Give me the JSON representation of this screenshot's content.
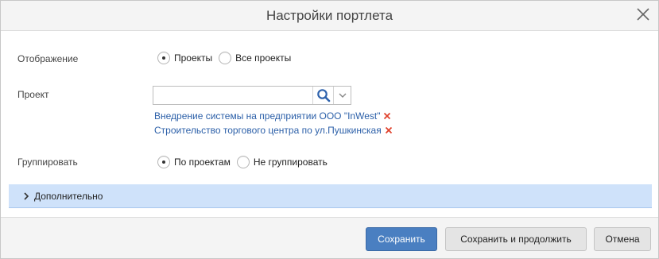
{
  "dialog": {
    "title": "Настройки портлета"
  },
  "form": {
    "display": {
      "label": "Отображение",
      "options": [
        {
          "label": "Проекты",
          "checked": true
        },
        {
          "label": "Все проекты",
          "checked": false
        }
      ]
    },
    "project": {
      "label": "Проект",
      "value": "",
      "selected": [
        "Внедрение системы на предприятии ООО \"InWest\"",
        "Строительство торгового центра по ул.Пушкинская"
      ]
    },
    "group": {
      "label": "Группировать",
      "options": [
        {
          "label": "По проектам",
          "checked": true
        },
        {
          "label": "Не группировать",
          "checked": false
        }
      ]
    }
  },
  "advanced": {
    "label": "Дополнительно"
  },
  "footer": {
    "save": "Сохранить",
    "save_continue": "Сохранить и продолжить",
    "cancel": "Отмена"
  },
  "colors": {
    "primary": "#4a7fc1",
    "link": "#2b5fa8",
    "remove": "#e0412c",
    "section": "#cfe2fa"
  }
}
